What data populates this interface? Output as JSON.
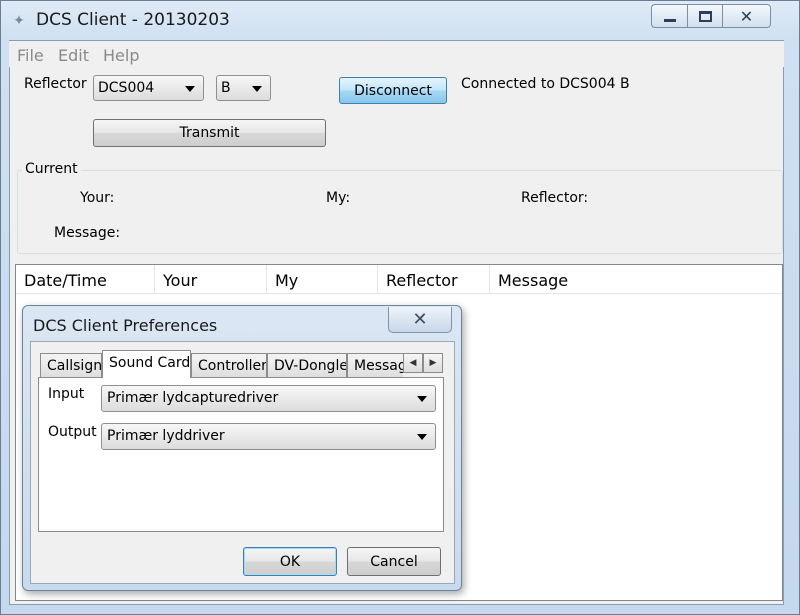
{
  "window": {
    "title": "DCS Client - 20130203",
    "icon": "pin-icon",
    "controls": {
      "minimize": "minimize-icon",
      "maximize": "maximize-icon",
      "close": "close-icon"
    }
  },
  "menu": {
    "items": [
      "File",
      "Edit",
      "Help"
    ]
  },
  "reflector": {
    "label": "Reflector",
    "selected": "DCS004",
    "module": "B",
    "disconnect_label": "Disconnect",
    "status": "Connected to DCS004 B",
    "transmit_label": "Transmit"
  },
  "current": {
    "title": "Current",
    "your_label": "Your:",
    "my_label": "My:",
    "reflector_label": "Reflector:",
    "message_label": "Message:"
  },
  "list": {
    "columns": [
      "Date/Time",
      "Your",
      "My",
      "Reflector",
      "Message"
    ],
    "rows": []
  },
  "dialog": {
    "title": "DCS Client Preferences",
    "close_glyph": "✕",
    "tabs": [
      "Callsign",
      "Sound Card",
      "Controller",
      "DV-Dongle",
      "Messag"
    ],
    "active_tab": "Sound Card",
    "scroll_left": "◀",
    "scroll_right": "▶",
    "input_label": "Input",
    "input_value": "Primær lydcapturedriver",
    "output_label": "Output",
    "output_value": "Primær lyddriver",
    "ok_label": "OK",
    "cancel_label": "Cancel"
  }
}
